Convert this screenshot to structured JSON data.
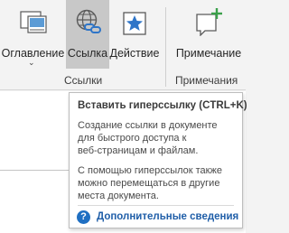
{
  "ribbon": {
    "buttons": {
      "toc": {
        "label": "Оглавление",
        "icon": "table-of-contents-icon"
      },
      "link": {
        "label": "Ссылка",
        "icon": "hyperlink-globe-icon"
      },
      "action": {
        "label": "Действие",
        "icon": "action-star-icon"
      },
      "comment": {
        "label": "Примечание",
        "icon": "new-comment-icon"
      }
    },
    "groups": {
      "links": "Ссылки",
      "comments": "Примечания"
    }
  },
  "tooltip": {
    "title": "Вставить гиперссылку (CTRL+K)",
    "p1": [
      "Создание ссылки в документе",
      "для быстрого доступа к",
      "веб-страницам и файлам."
    ],
    "p2": [
      "С помощью гиперссылок также",
      "можно перемещаться в другие",
      "места документа."
    ],
    "help_link": "Дополнительные сведения"
  },
  "colors": {
    "accent": "#1f5ea8",
    "pressed_button": "#c8c8c8",
    "ribbon_bg": "#f3f3f3"
  }
}
